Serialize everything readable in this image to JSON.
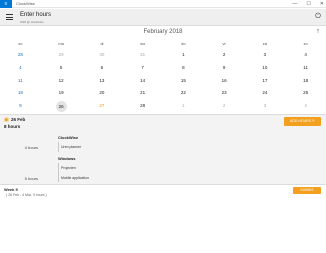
{
  "window": {
    "app_title": "ClockWise",
    "app_tile_glyph": "≡",
    "controls": [
      "—",
      "☐",
      "✕"
    ]
  },
  "header": {
    "title": "Enter hours",
    "subtitle": "Wk8 @ clockwise"
  },
  "calendar": {
    "month": "February 2018",
    "days_of_week": [
      "zo",
      "ma",
      "di",
      "wo",
      "do",
      "vr",
      "za",
      "zo"
    ],
    "weeks": [
      [
        {
          "d": "28",
          "t": "sunday"
        },
        {
          "d": "29",
          "t": "muted"
        },
        {
          "d": "30",
          "t": "muted"
        },
        {
          "d": "31",
          "t": "muted"
        },
        {
          "d": "1",
          "t": ""
        },
        {
          "d": "2",
          "t": ""
        },
        {
          "d": "3",
          "t": ""
        },
        {
          "d": "4",
          "t": ""
        }
      ],
      [
        {
          "d": "4",
          "t": "sunday"
        },
        {
          "d": "5",
          "t": ""
        },
        {
          "d": "6",
          "t": ""
        },
        {
          "d": "7",
          "t": ""
        },
        {
          "d": "8",
          "t": ""
        },
        {
          "d": "9",
          "t": ""
        },
        {
          "d": "10",
          "t": ""
        },
        {
          "d": "11",
          "t": ""
        }
      ],
      [
        {
          "d": "11",
          "t": "sunday"
        },
        {
          "d": "12",
          "t": ""
        },
        {
          "d": "13",
          "t": ""
        },
        {
          "d": "14",
          "t": ""
        },
        {
          "d": "15",
          "t": ""
        },
        {
          "d": "16",
          "t": ""
        },
        {
          "d": "17",
          "t": ""
        },
        {
          "d": "18",
          "t": ""
        }
      ],
      [
        {
          "d": "18",
          "t": "sunday"
        },
        {
          "d": "19",
          "t": ""
        },
        {
          "d": "20",
          "t": ""
        },
        {
          "d": "21",
          "t": ""
        },
        {
          "d": "22",
          "t": ""
        },
        {
          "d": "23",
          "t": ""
        },
        {
          "d": "24",
          "t": ""
        },
        {
          "d": "25",
          "t": ""
        }
      ],
      [
        {
          "d": "9",
          "t": "sunday"
        },
        {
          "d": "26",
          "t": "selected"
        },
        {
          "d": "27",
          "t": "highlight"
        },
        {
          "d": "28",
          "t": ""
        },
        {
          "d": "1",
          "t": "muted"
        },
        {
          "d": "2",
          "t": "muted"
        },
        {
          "d": "3",
          "t": "muted"
        },
        {
          "d": "4",
          "t": "muted"
        }
      ]
    ]
  },
  "detail": {
    "date": "26 Feb",
    "total": "8 hours",
    "add_button": "ADD HOURS ✎",
    "projects": [
      {
        "name": "ClockWise",
        "entries": [
          {
            "hours": "4 hours",
            "text": "Uren planner"
          }
        ]
      },
      {
        "name": "Windows",
        "entries": [
          {
            "hours": "",
            "text": "Projecten"
          },
          {
            "hours": "5 hours",
            "text": "Mobile application"
          }
        ]
      }
    ]
  },
  "week_footer": {
    "label": "Week 9",
    "range": "( 26 Feb - 4 Mar, 9 hours )",
    "submit": "SUBMIT"
  },
  "colors": {
    "accent": "#f2a01e",
    "sunday": "#1f6fbf",
    "selected_bg": "#e3e3e3"
  }
}
